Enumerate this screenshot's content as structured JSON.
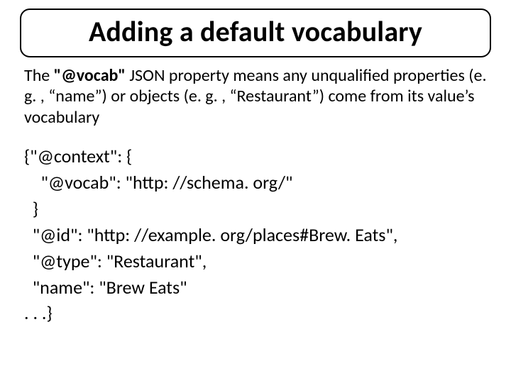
{
  "title": "Adding a default vocabulary",
  "desc": {
    "pre": "The ",
    "bold": "\"@vocab\"",
    "post": " JSON property means any unqualified properties (e. g. , “name”) or objects (e. g. , “Restaurant”) come from its value’s vocabulary"
  },
  "code": {
    "l1": "{\"@context\": {",
    "l2": "    \"@vocab\": \"http: //schema. org/\"",
    "l3": "  }",
    "l4": "  \"@id\": \"http: //example. org/places#Brew. Eats\",",
    "l5": "  \"@type\": \"Restaurant\",",
    "l6": "  \"name\": \"Brew Eats\"",
    "l7": ". . .}"
  }
}
